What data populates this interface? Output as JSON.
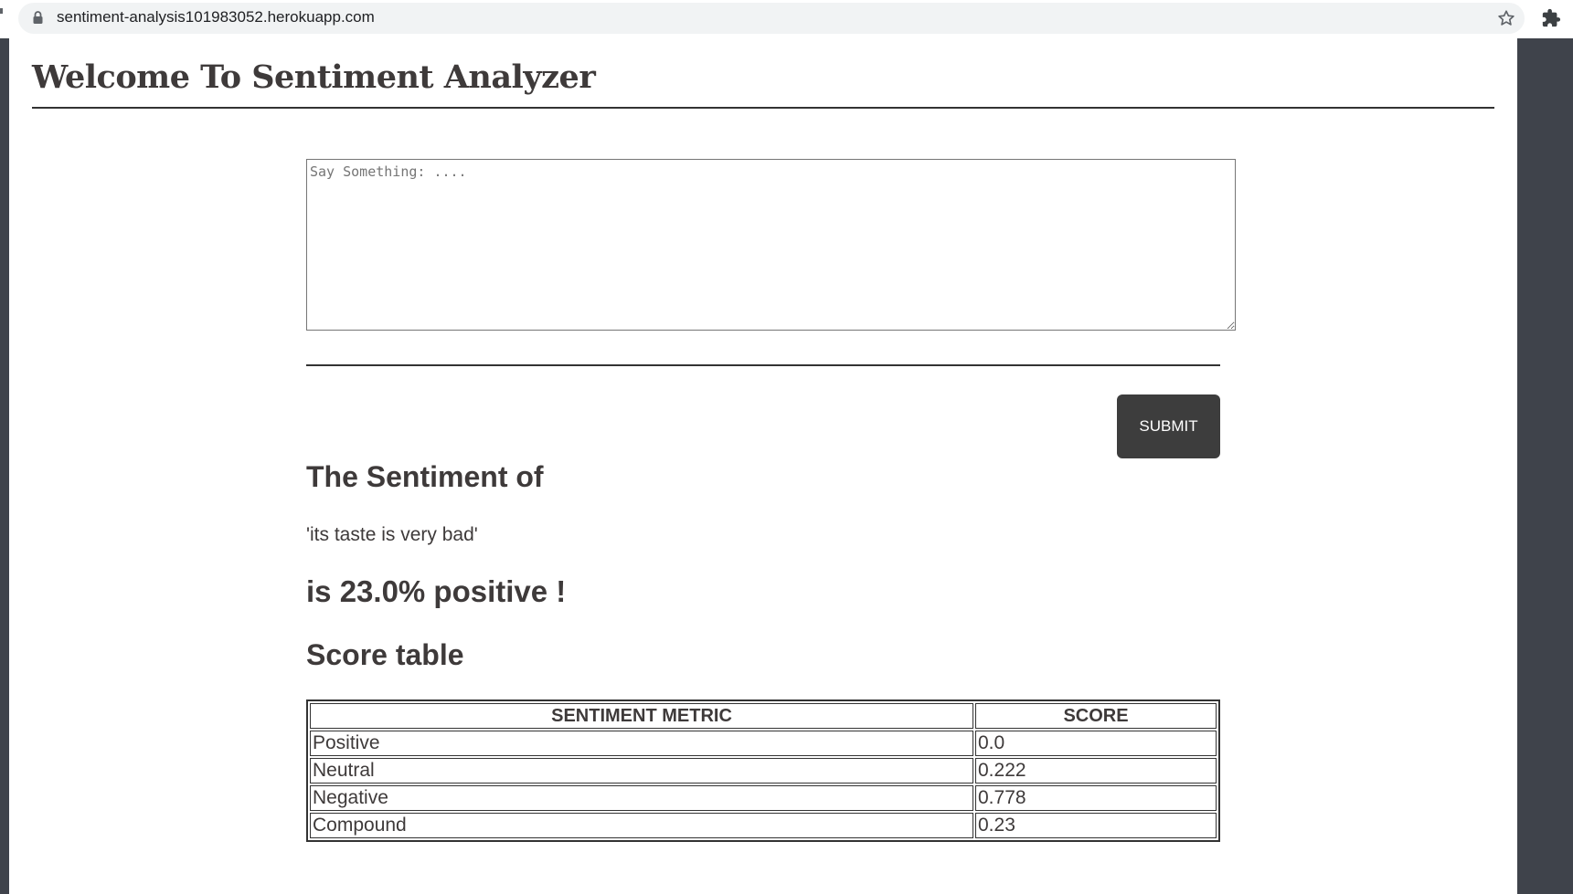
{
  "browser": {
    "url": "sentiment-analysis101983052.herokuapp.com",
    "icons": [
      "lock-icon",
      "star-icon",
      "extensions-icon"
    ]
  },
  "page": {
    "title": "Welcome To Sentiment Analyzer",
    "textarea_placeholder": "Say Something: ....",
    "textarea_value": "",
    "submit_label": "SUBMIT",
    "sentiment_of_heading": "The Sentiment of",
    "analyzed_text": "'its taste is very bad'",
    "result_heading": "is 23.0% positive !",
    "score_table_heading": "Score table"
  },
  "score_table": {
    "headers": [
      "SENTIMENT METRIC",
      "SCORE"
    ],
    "rows": [
      {
        "metric": "Positive",
        "score": "0.0"
      },
      {
        "metric": "Neutral",
        "score": "0.222"
      },
      {
        "metric": "Negative",
        "score": "0.778"
      },
      {
        "metric": "Compound",
        "score": "0.23"
      }
    ]
  },
  "colors": {
    "text": "#3e3a3a",
    "button_bg": "#3d3d3d",
    "button_text": "#ffffff",
    "side_bg": "#3f434b",
    "omnibox_bg": "#f1f3f4"
  }
}
